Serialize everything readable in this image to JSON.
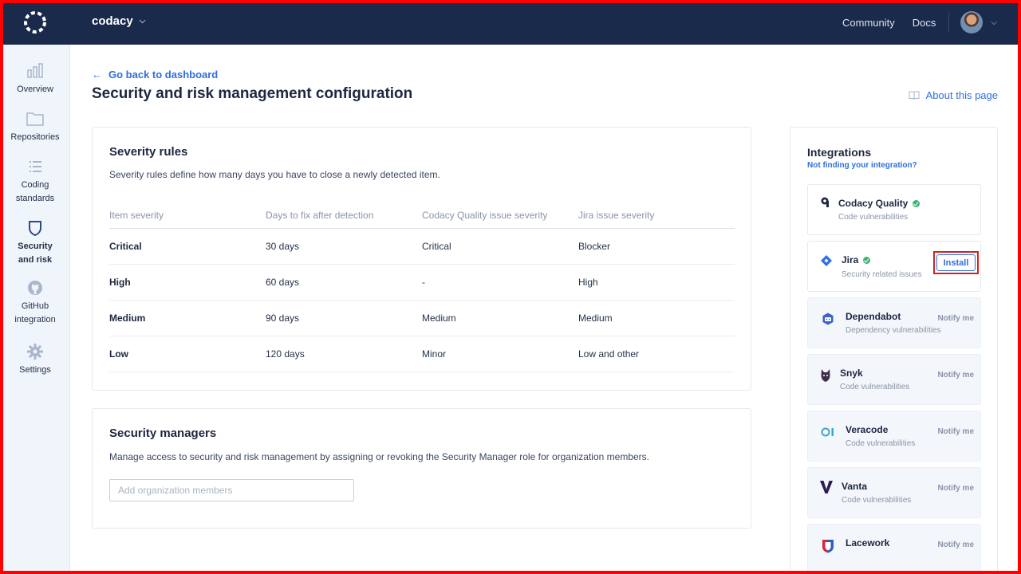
{
  "topbar": {
    "org_name": "codacy",
    "nav": [
      "Community",
      "Docs"
    ]
  },
  "sidebar": {
    "items": [
      {
        "label": "Overview",
        "icon": "bar-chart-icon"
      },
      {
        "label": "Repositories",
        "icon": "folder-icon"
      },
      {
        "label": "Coding standards",
        "icon": "list-icon"
      },
      {
        "label": "Security and risk",
        "icon": "shield-icon"
      },
      {
        "label": "GitHub integration",
        "icon": "github-icon"
      },
      {
        "label": "Settings",
        "icon": "gear-icon"
      }
    ]
  },
  "header": {
    "back_label": "Go back to dashboard",
    "title": "Security and risk management configuration",
    "about_label": "About this page"
  },
  "severity": {
    "title": "Severity rules",
    "description": "Severity rules define how many days you have to close a newly detected item.",
    "columns": [
      "Item severity",
      "Days to fix after detection",
      "Codacy Quality issue severity",
      "Jira issue severity"
    ],
    "rows": [
      [
        "Critical",
        "30 days",
        "Critical",
        "Blocker"
      ],
      [
        "High",
        "60 days",
        "-",
        "High"
      ],
      [
        "Medium",
        "90 days",
        "Medium",
        "Medium"
      ],
      [
        "Low",
        "120 days",
        "Minor",
        "Low and other"
      ]
    ]
  },
  "managers": {
    "title": "Security managers",
    "description": "Manage access to security and risk management by assigning or revoking the Security Manager role for organization members.",
    "input_placeholder": "Add organization members"
  },
  "integrations": {
    "title": "Integrations",
    "link": "Not finding your integration?",
    "install_label": "Install",
    "notify_label": "Notify me",
    "items": [
      {
        "name": "Codacy Quality",
        "sub": "Code vulnerabilities",
        "status": "connected"
      },
      {
        "name": "Jira",
        "sub": "Security related issues",
        "status": "install"
      },
      {
        "name": "Dependabot",
        "sub": "Dependency vulnerabilities",
        "status": "notify"
      },
      {
        "name": "Snyk",
        "sub": "Code vulnerabilities",
        "status": "notify"
      },
      {
        "name": "Veracode",
        "sub": "Code vulnerabilities",
        "status": "notify"
      },
      {
        "name": "Vanta",
        "sub": "Code vulnerabilities",
        "status": "notify"
      },
      {
        "name": "Lacework",
        "sub": "",
        "status": "notify"
      }
    ]
  },
  "colors": {
    "topbar": "#1a2a4a",
    "accent": "#2f6fe0",
    "success": "#3cb371",
    "highlight": "#d21f1f"
  }
}
